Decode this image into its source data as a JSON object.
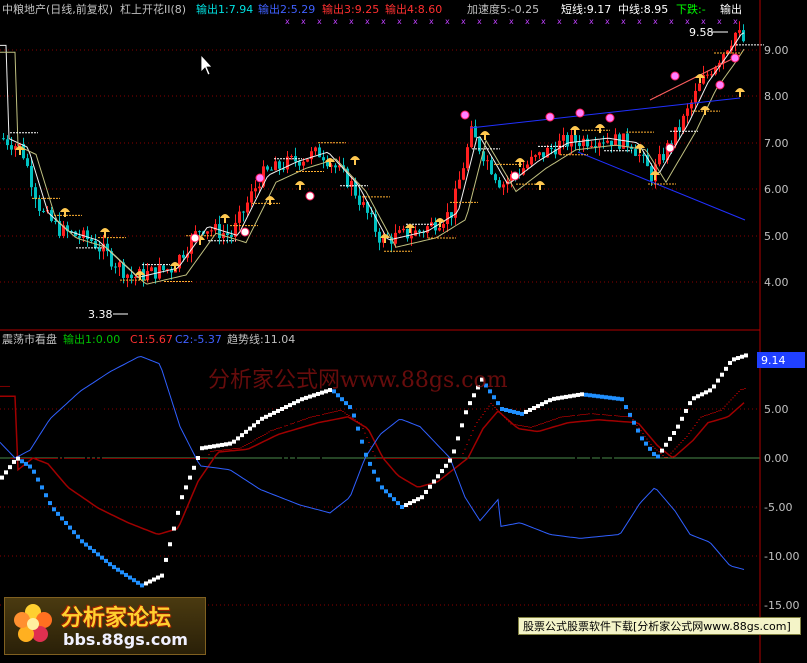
{
  "top_panel": {
    "stock": "中粮地产(日线,前复权)",
    "indicator": "杠上开花II(8)",
    "out1": "输出1:7.94",
    "out2": "输出2:5.29",
    "out3": "输出3:9.25",
    "out4": "输出4:8.60",
    "accel": "加速度5:-0.25",
    "short": "短线:9.17",
    "mid": "中线:8.95",
    "trend": "下跌:-",
    "out_tail": "输出",
    "high_label": "9.58",
    "low_label": "3.38",
    "axis": [
      "9.00",
      "8.00",
      "7.00",
      "6.00",
      "5.00",
      "4.00"
    ]
  },
  "bottom_panel": {
    "title": "震荡市看盘",
    "out1": "输出1:0.00",
    "c1": "C1:5.67",
    "c2": "C2:-5.37",
    "trendline": "趋势线:11.04",
    "current": "9.14",
    "axis": [
      "5.00",
      "0.00",
      "-5.00",
      "-10.00",
      "-15.00"
    ]
  },
  "watermark": "分析家公式网www.88gs.com",
  "logo": {
    "main": "分析家论坛",
    "sub": "bbs.88gs.com"
  },
  "banner": "股票公式股票软件下载[分析家公式网www.88gs.com]",
  "colors": {
    "up": "#ff2020",
    "down": "#00c8c8",
    "label_cyan": "#00e0e0",
    "label_blue": "#4060ff",
    "label_red": "#ff3030",
    "axis": "#b00000"
  }
}
